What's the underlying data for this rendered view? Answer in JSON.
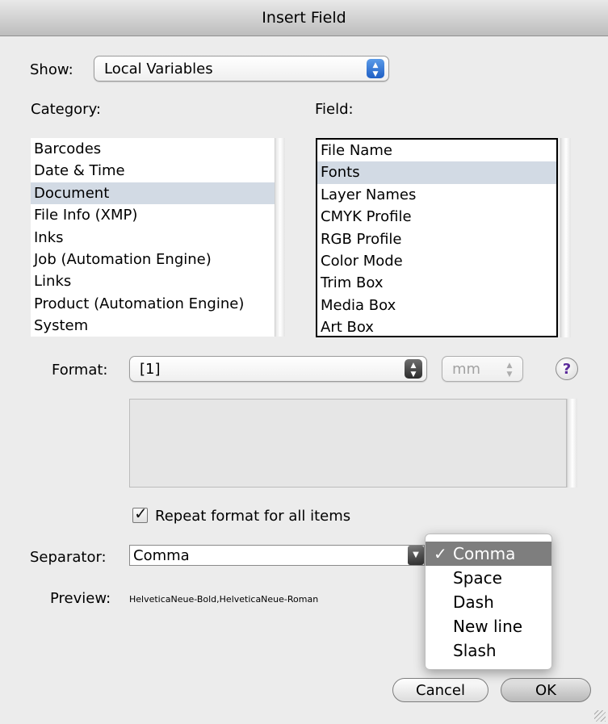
{
  "window": {
    "title": "Insert Field"
  },
  "show": {
    "label": "Show:",
    "value": "Local Variables"
  },
  "category": {
    "label": "Category:",
    "items": [
      "Barcodes",
      "Date & Time",
      "Document",
      "File Info (XMP)",
      "Inks",
      "Job (Automation Engine)",
      "Links",
      "Product (Automation Engine)",
      "System"
    ],
    "selected": "Document"
  },
  "field": {
    "label": "Field:",
    "items": [
      "File Name",
      "Fonts",
      "Layer Names",
      "CMYK Profile",
      "RGB Profile",
      "Color Mode",
      "Trim Box",
      "Media Box",
      "Art Box"
    ],
    "selected": "Fonts"
  },
  "format": {
    "label": "Format:",
    "value": "[1]",
    "unit": "mm",
    "help": "?"
  },
  "repeat": {
    "label": "Repeat format for all items",
    "checked": true
  },
  "separator": {
    "label": "Separator:",
    "value": "Comma",
    "options": [
      "Comma",
      "Space",
      "Dash",
      "New line",
      "Slash"
    ]
  },
  "preview": {
    "label": "Preview:",
    "value": "HelveticaNeue-Bold,HelveticaNeue-Roman"
  },
  "buttons": {
    "cancel": "Cancel",
    "ok": "OK"
  }
}
